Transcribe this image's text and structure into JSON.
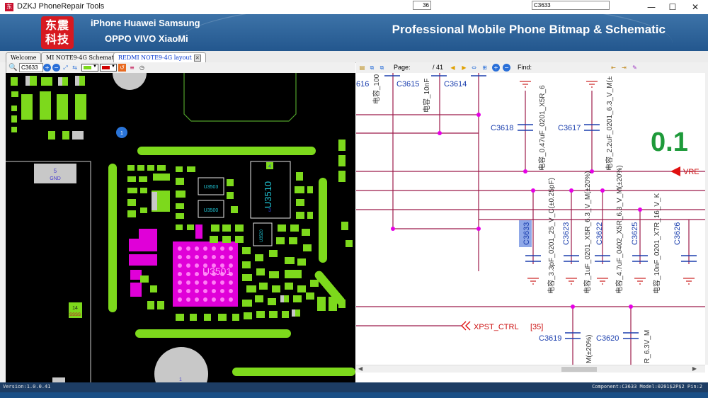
{
  "window": {
    "title": "DZKJ PhoneRepair Tools",
    "icon_glyph": "东",
    "controls": {
      "minimize": "—",
      "maximize": "☐",
      "close": "✕"
    }
  },
  "banner": {
    "logo_line1": "东震",
    "logo_line2": "科技",
    "brands_line1": "iPhone Huawei Samsung",
    "brands_line2": "OPPO VIVO XiaoMi",
    "slogan": "Professional Mobile Phone Bitmap & Schematic"
  },
  "tabs": [
    {
      "label": "Welcome",
      "active": false
    },
    {
      "label": "MI NOTE9-4G Schematic",
      "active": false
    },
    {
      "label": "REDMI NOTE9-4G layout",
      "active": true
    }
  ],
  "left_toolbar": {
    "search_value": "C3633",
    "icons": [
      "search-icon",
      "zoom-in-icon",
      "zoom-out-icon",
      "fit-icon",
      "flip-icon",
      "color-picker-icon",
      "color-picker-icon",
      "reset-icon",
      "menu-icon",
      "clock-icon"
    ]
  },
  "board": {
    "labels": {
      "gnd": "5",
      "gnd_name": "GND",
      "pad_14": "14",
      "pad_14_name": "SSSS",
      "pad_1_top": "1",
      "pad_1_bottom": "1",
      "u3510": "U3510",
      "u3503": "U3503",
      "u3500": "U3500",
      "u3501": "U3501",
      "u3520": "U3520",
      "u3510_pin": "4",
      "u3510_pin_b": "3"
    },
    "component_numbers": [
      "1",
      "2",
      "1",
      "2",
      "2",
      "1",
      "2",
      "1",
      "2",
      "1",
      "2",
      "1",
      "2",
      "1",
      "2",
      "1",
      "2",
      "1",
      "2",
      "1",
      "2",
      "1",
      "2",
      "1",
      "2",
      "1",
      "2",
      "1",
      "2",
      "1"
    ]
  },
  "right_toolbar": {
    "page_label": "Page:",
    "page_current": "36",
    "page_total": "/ 41",
    "find_label": "Find:",
    "find_value": "C3633"
  },
  "schematic": {
    "top_refs": [
      "616",
      "C3615",
      "C3614"
    ],
    "top_values": [
      "电容_100",
      "电容_10nF"
    ],
    "caps": [
      {
        "ref": "C3618",
        "value": "电容_0.47uF_0201_X5R_6"
      },
      {
        "ref": "C3617",
        "value": "电容_2.2uF_0201_6.3_V_M(±"
      },
      {
        "ref": "C3633",
        "value": "电容_3.3pF_0201_25_V_C(±0.25pF)"
      },
      {
        "ref": "C3623",
        "value": "电容_1uF_0201_X5R_6.3_V_M(±20%)"
      },
      {
        "ref": "C3622",
        "value": "电容_4.7uF_0402_X5R_6.3_V_M(±20%)"
      },
      {
        "ref": "C3625",
        "value": "电容_10nF_0201_X7R_16_V_K"
      },
      {
        "ref": "C3626",
        "value": ""
      },
      {
        "ref": "C3619",
        "value": "M(±20%)"
      },
      {
        "ref": "C3620",
        "value": "R_6.3V_M"
      }
    ],
    "big_value": "0.1",
    "vref_label": "VRE",
    "net_label": "XPST_CTRL",
    "net_ref": "[35]"
  },
  "status": {
    "version": "Version:1.0.0.41",
    "component_info": "Component:C3633 Model:0201$2P$2 Pin:2"
  },
  "colors": {
    "pcb_bg": "#000000",
    "pad_green": "#7dd91c",
    "chip_magenta": "#e000d8",
    "net_line": "#9c1a4a",
    "junction": "#e600e6",
    "highlight": "#8fa8e8",
    "big_value": "#1e9a3a",
    "net_arrow": "#e01010"
  }
}
